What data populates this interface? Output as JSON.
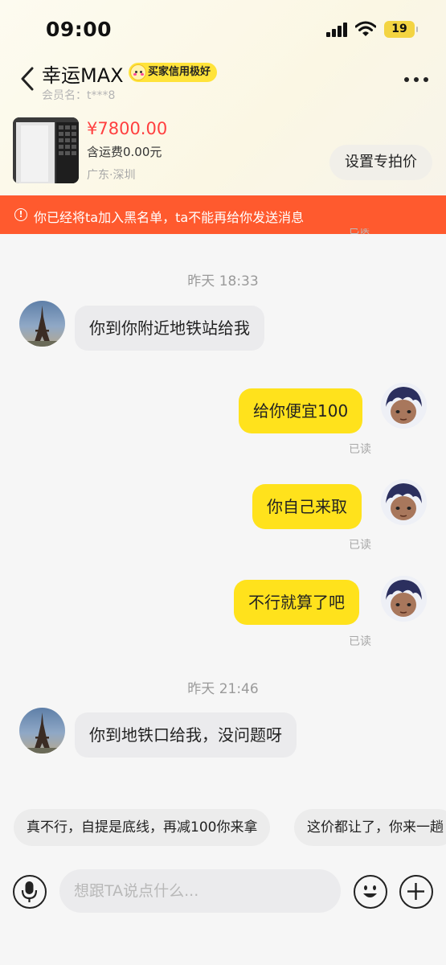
{
  "status_bar": {
    "time": "09:00",
    "battery": "19"
  },
  "header": {
    "title": "幸运MAX",
    "credit_badge": "买家信用极好",
    "member_label": "会员名：t***8"
  },
  "product": {
    "price": "¥7800.00",
    "shipping": "含运费0.00元",
    "location": "广东·深圳",
    "set_price_button": "设置专拍价"
  },
  "warning": {
    "text": "你已经将ta加入黑名单，ta不能再给你发送消息"
  },
  "chat": {
    "partial_read": "已读",
    "timestamp_1": "昨天 18:33",
    "msg_1": "你到你附近地铁站给我",
    "msg_2": "给你便宜100",
    "msg_2_status": "已读",
    "msg_3": "你自己来取",
    "msg_3_status": "已读",
    "msg_4": "不行就算了吧",
    "msg_4_status": "已读",
    "timestamp_2": "昨天 21:46",
    "msg_5": "你到地铁口给我，没问题呀"
  },
  "quick_replies": [
    "真不行，自提是底线，再减100你来拿",
    "这价都让了，你来一趟"
  ],
  "input_bar": {
    "placeholder": "想跟TA说点什么..."
  },
  "icons": {
    "back": "chevron-left-icon",
    "more": "more-dots-icon",
    "mic": "microphone-icon",
    "emoji": "emoji-icon",
    "add": "plus-icon",
    "warning": "info-circle-icon"
  },
  "colors": {
    "accent_yellow": "#ffe21c",
    "price_red": "#ff4040",
    "warning_orange": "#ff5a2e"
  }
}
